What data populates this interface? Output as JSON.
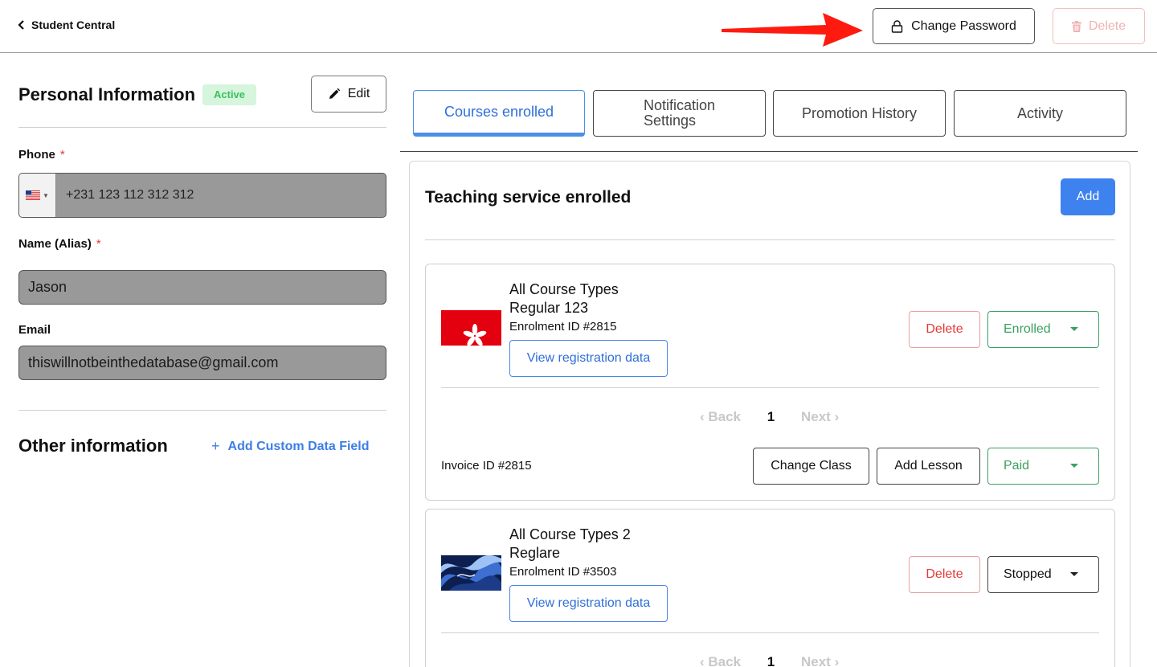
{
  "topbar": {
    "back_label": "Student Central",
    "change_password_label": "Change Password",
    "delete_label": "Delete"
  },
  "personal": {
    "title": "Personal Information",
    "status_badge": "Active",
    "edit_label": "Edit",
    "phone_label": "Phone",
    "phone_value": "+231 123 112 312 312",
    "name_label": "Name (Alias)",
    "name_value": "Jason",
    "email_label": "Email",
    "email_value": "thiswillnotbeinthedatabase@gmail.com",
    "required_mark": "*"
  },
  "other": {
    "title": "Other information",
    "add_custom_label": "Add Custom Data Field",
    "plus": "+"
  },
  "tabs": [
    {
      "label": "Courses enrolled"
    },
    {
      "label_line1": "Notification",
      "label_line2": "Settings"
    },
    {
      "label": "Promotion History"
    },
    {
      "label": "Activity"
    }
  ],
  "panel": {
    "title": "Teaching service enrolled",
    "add_label": "Add",
    "courses": [
      {
        "course_type": "All Course Types",
        "course_name": "Regular 123",
        "enrolment_id": "Enrolment ID #2815",
        "view_label": "View registration data",
        "delete_label": "Delete",
        "status": "Enrolled",
        "pager": {
          "back": "Back",
          "page": "1",
          "next": "Next"
        },
        "invoice_id": "Invoice ID #2815",
        "change_class_label": "Change Class",
        "add_lesson_label": "Add Lesson",
        "payment_status": "Paid"
      },
      {
        "course_type": "All Course Types 2",
        "course_name": "Reglare",
        "enrolment_id": "Enrolment ID #3503",
        "view_label": "View registration data",
        "delete_label": "Delete",
        "status": "Stopped",
        "pager": {
          "back": "Back",
          "page": "1",
          "next": "Next"
        }
      }
    ]
  },
  "icons": {
    "back": "chevron-left-icon",
    "lock": "lock-icon",
    "trash": "trash-icon",
    "pencil": "pencil-icon",
    "flag": "liberia-flag-icon",
    "annotation": "red-arrow-annotation"
  },
  "colors": {
    "accent_blue": "#3e82ef",
    "danger_red": "#e53935",
    "success_green": "#3aa160",
    "badge_bg": "#d5f5dd",
    "input_fill": "#999999"
  }
}
